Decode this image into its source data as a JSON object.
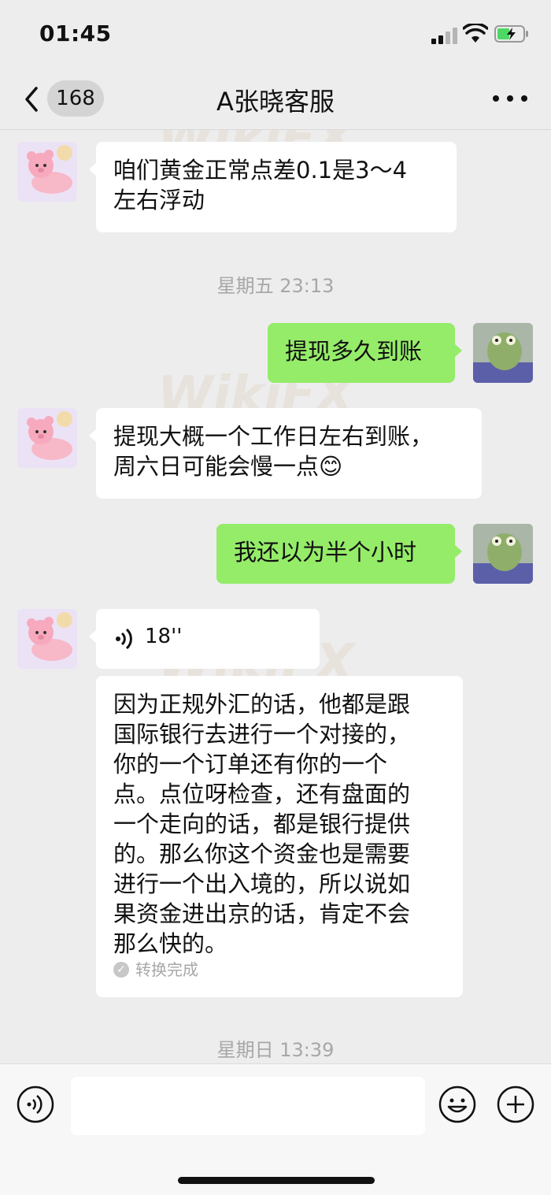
{
  "status": {
    "time": "01:45"
  },
  "nav": {
    "unread_count": "168",
    "title": "A张晓客服"
  },
  "messages": [
    {
      "side": "in",
      "text_line1": "咱们黄金正常点差0.1是3～4",
      "text_line2": "左右浮动"
    },
    {
      "timestamp": "星期五 23:13"
    },
    {
      "side": "out",
      "text": "提现多久到账"
    },
    {
      "side": "in",
      "text_line1": "提现大概一个工作日左右到账，",
      "text_line2": "周六日可能会慢一点😊"
    },
    {
      "side": "out",
      "text": "我还以为半个小时"
    },
    {
      "side": "in",
      "type": "voice",
      "duration": "18''",
      "transcript": [
        "因为正规外汇的话，他都是跟",
        "国际银行去进行一个对接的，",
        "你的一个订单还有你的一个",
        "点。点位呀检查，还有盘面的",
        "一个走向的话，都是银行提供",
        "的。那么你这个资金也是需要",
        "进行一个出入境的，所以说如",
        "果资金进出京的话，肯定不会",
        "那么快的。"
      ],
      "transcript_status": "转换完成"
    },
    {
      "timestamp": "星期日 13:39"
    }
  ],
  "watermark": "WikiFX",
  "input": {
    "value": "",
    "placeholder": ""
  },
  "colors": {
    "outgoing_bubble": "#95ec69",
    "incoming_bubble": "#ffffff",
    "background": "#ededed"
  },
  "icons": [
    "back-icon",
    "more-icon",
    "voice-wave-icon",
    "emoji-icon",
    "plus-icon",
    "signal-icon",
    "wifi-icon",
    "battery-icon"
  ]
}
